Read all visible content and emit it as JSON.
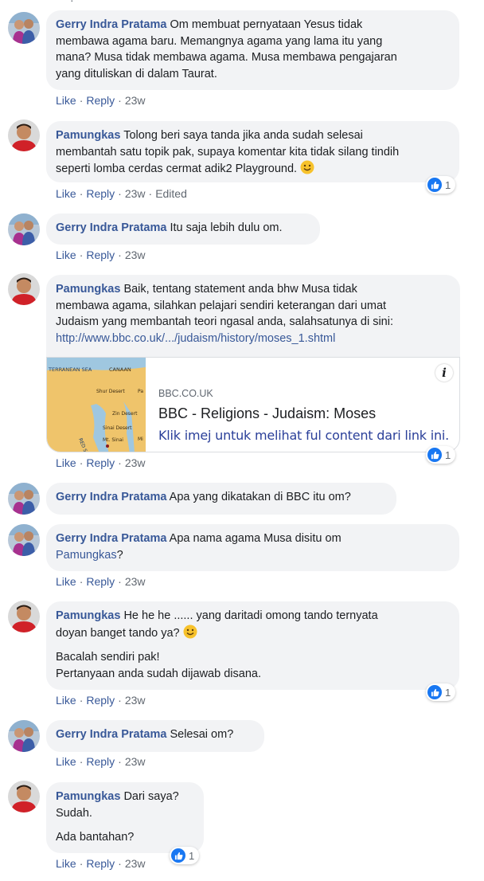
{
  "actions": {
    "like": "Like",
    "reply": "Reply",
    "edited": "Edited",
    "sep": "·"
  },
  "comments": [
    {
      "author": "Gerry Indra Pratama",
      "lines": [
        "Om membuat pernyataan Yesus tidak",
        "membawa agama baru. Memangnya agama yang lama itu yang",
        "mana? Musa tidak membawa agama. Musa membawa pengajaran",
        "yang dituliskan di dalam Taurat."
      ],
      "time": "23w"
    },
    {
      "author": "Pamungkas",
      "lines": [
        "Tolong beri saya tanda jika anda sudah selesai",
        "membantah satu topik pak, supaya komentar kita tidak silang tindih",
        "seperti lomba cerdas cermat adik2 Playground."
      ],
      "time": "23w",
      "reactions": "1"
    },
    {
      "author": "Gerry Indra Pratama",
      "text": "Itu saja lebih dulu om.",
      "time": "23w"
    },
    {
      "author": "Pamungkas",
      "lines": [
        "Baik, tentang statement anda bhw Musa tidak",
        "membawa agama, silahkan pelajari sendiri keterangan dari umat",
        "Judaism yang membantah teori ngasal anda, salahsatunya di sini:"
      ],
      "link": "http://www.bbc.co.uk/.../judaism/history/moses_1.shtml",
      "time": "23w",
      "reactions": "1",
      "preview": {
        "domain": "BBC.CO.UK",
        "title": "BBC - Religions - Judaism: Moses",
        "description": "Klik imej untuk melihat ful content dari link ini.",
        "map_labels": [
          "TERRANEAN SEA",
          "CANAAN",
          "Shur Desert",
          "Zin Desert",
          "Sinai Desert",
          "Mt. Sinai",
          "RED SEA",
          "Pa",
          "Mi"
        ]
      }
    },
    {
      "author": "Gerry Indra Pratama",
      "text": "Apa yang dikatakan di BBC itu om?"
    },
    {
      "author": "Gerry Indra Pratama",
      "text": "Apa nama agama Musa disitu om",
      "mention": "Pamungkas",
      "suffix": "?",
      "time": "23w"
    },
    {
      "author": "Pamungkas",
      "lines": [
        "He he he ...... yang daritadi omong tando ternyata",
        "doyan banget tando ya?"
      ],
      "lines2": [
        "Bacalah sendiri pak!",
        "Pertanyaan anda sudah dijawab disana."
      ],
      "time": "23w",
      "reactions": "1"
    },
    {
      "author": "Gerry Indra Pratama",
      "text": "Selesai om?",
      "time": "23w"
    },
    {
      "author": "Pamungkas",
      "lines": [
        "Dari saya?",
        "Sudah."
      ],
      "lines2": [
        "Ada bantahan?"
      ],
      "time": "23w",
      "reactions": "1"
    }
  ],
  "colors": {
    "name": "#385898",
    "bubble": "#f2f3f5",
    "like_blue": "#1877f2",
    "meta": "#606770"
  }
}
